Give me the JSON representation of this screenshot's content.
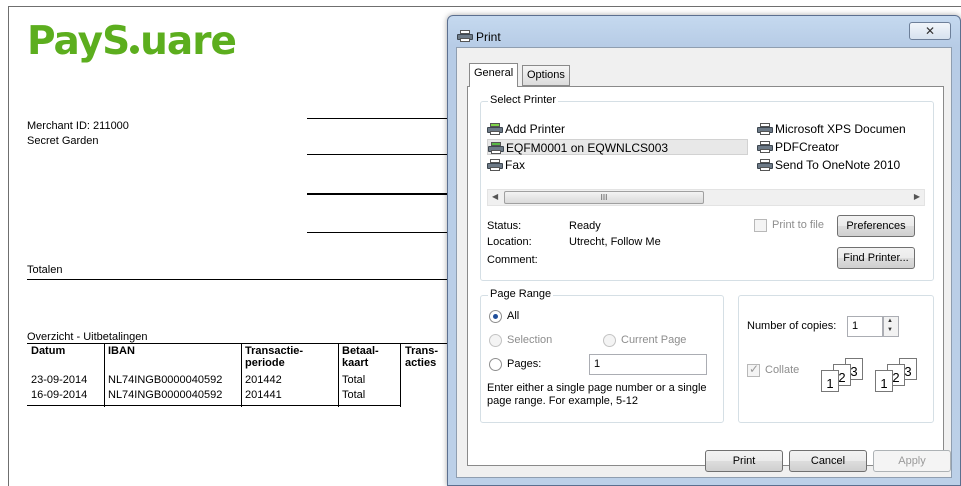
{
  "document": {
    "logo": {
      "part1": "PayS",
      "part2": "uare"
    },
    "merchant_id_label": "Merchant ID:",
    "merchant_id_value": "211000",
    "merchant_name": "Secret Garden",
    "totals_heading": "Totalen",
    "overview_heading": "Overzicht - Uitbetalingen",
    "table": {
      "headers": [
        "Datum",
        "IBAN",
        "Transactie-\nperiode",
        "Betaal-\nkaart",
        "Trans-\nacties"
      ],
      "rows": [
        {
          "date": "23-09-2014",
          "iban": "NL74INGB0000040592",
          "period": "201442",
          "card": "Total"
        },
        {
          "date": "16-09-2014",
          "iban": "NL74INGB0000040592",
          "period": "201441",
          "card": "Total"
        }
      ]
    }
  },
  "dialog": {
    "title": "Print",
    "close_glyph": "✕",
    "tabs": [
      {
        "label": "General"
      },
      {
        "label": "Options"
      }
    ],
    "select_printer": {
      "group_label": "Select Printer",
      "printers": [
        {
          "name": "Add Printer",
          "icon": "add-printer-icon"
        },
        {
          "name": "Microsoft XPS Documen",
          "icon": "printer-icon"
        },
        {
          "name": "EQFM0001 on EQWNLCS003",
          "icon": "network-printer-icon",
          "selected": true
        },
        {
          "name": "PDFCreator",
          "icon": "printer-icon"
        },
        {
          "name": "Fax",
          "icon": "fax-icon"
        },
        {
          "name": "Send To OneNote 2010",
          "icon": "printer-icon"
        }
      ],
      "scroll_thumb_glyph": "III",
      "status_label": "Status:",
      "status_value": "Ready",
      "location_label": "Location:",
      "location_value": "Utrecht, Follow Me",
      "comment_label": "Comment:",
      "print_to_file_label": "Print to file",
      "preferences_button": "Preferences",
      "find_printer_button": "Find Printer..."
    },
    "page_range": {
      "group_label": "Page Range",
      "all_label": "All",
      "selection_label": "Selection",
      "current_page_label": "Current Page",
      "pages_label": "Pages:",
      "pages_value": "1",
      "help_line1": "Enter either a single page number or a single",
      "help_line2": "page range.  For example, 5-12",
      "selected_option": "All"
    },
    "copies": {
      "number_label": "Number of copies:",
      "number_value": "1",
      "collate_label": "Collate",
      "collate_checked": true,
      "sheet_numbers": [
        "1",
        "2",
        "3"
      ]
    },
    "footer": {
      "print_button": "Print",
      "cancel_button": "Cancel",
      "apply_button": "Apply"
    }
  }
}
